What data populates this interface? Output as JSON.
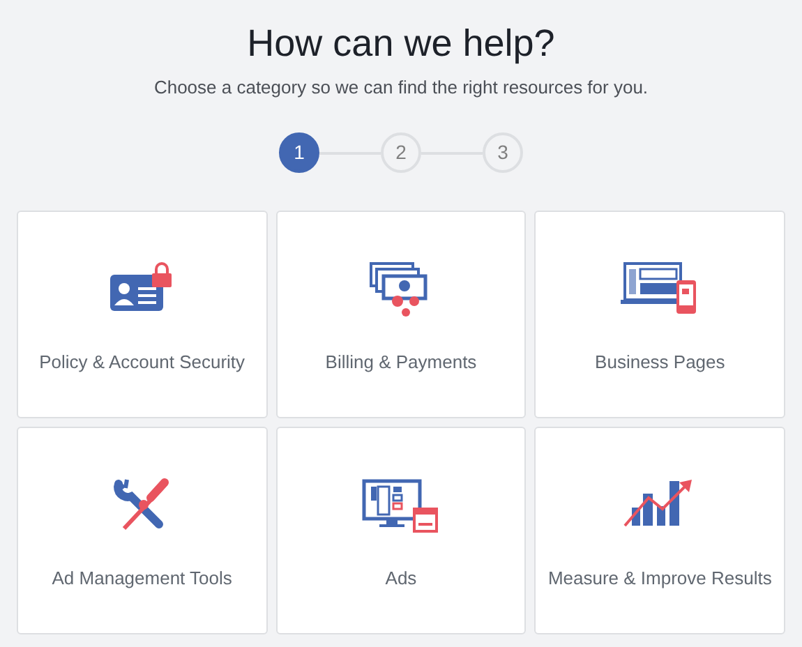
{
  "title": "How can we help?",
  "subtitle": "Choose a category so we can find the right resources for you.",
  "steps": [
    {
      "label": "1",
      "selected": true
    },
    {
      "label": "2",
      "selected": false
    },
    {
      "label": "3",
      "selected": false
    }
  ],
  "categories": [
    {
      "label": "Policy & Account Security",
      "kind": "id-card"
    },
    {
      "label": "Billing & Payments",
      "kind": "money"
    },
    {
      "label": "Business Pages",
      "kind": "devices"
    },
    {
      "label": "Ad Management Tools",
      "kind": "tools"
    },
    {
      "label": "Ads",
      "kind": "monitor"
    },
    {
      "label": "Measure & Improve Results",
      "kind": "chart"
    }
  ]
}
